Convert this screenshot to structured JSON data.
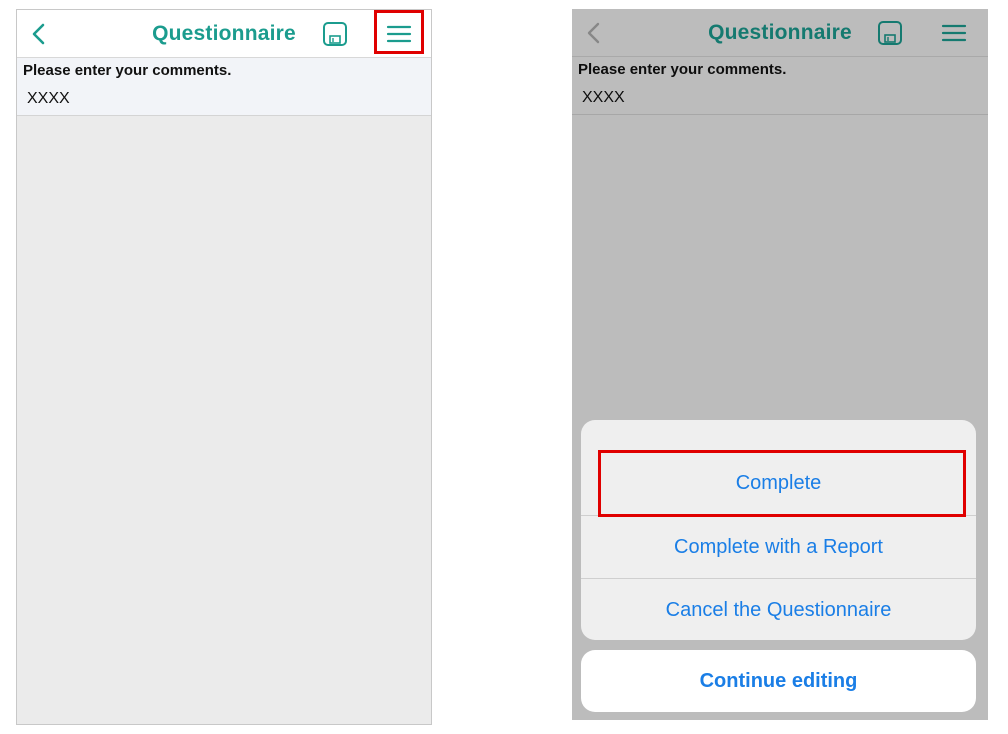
{
  "screens": {
    "editing": {
      "title": "Questionnaire",
      "question": {
        "label": "Please enter your comments.",
        "answer": "XXXX"
      }
    },
    "menu_open": {
      "title": "Questionnaire",
      "question": {
        "label": "Please enter your comments.",
        "answer": "XXXX"
      },
      "action_sheet": {
        "items": [
          {
            "label": "Complete"
          },
          {
            "label": "Complete with a Report"
          },
          {
            "label": "Cancel the Questionnaire"
          }
        ],
        "cancel_label": "Continue editing"
      }
    }
  },
  "icons": {
    "back": "chevron-left-icon",
    "save": "floppy-disk-icon",
    "menu": "hamburger-menu-icon"
  },
  "colors": {
    "accent": "#1b9c8e",
    "action_blue": "#1a7ee6",
    "highlight": "#e00000"
  }
}
